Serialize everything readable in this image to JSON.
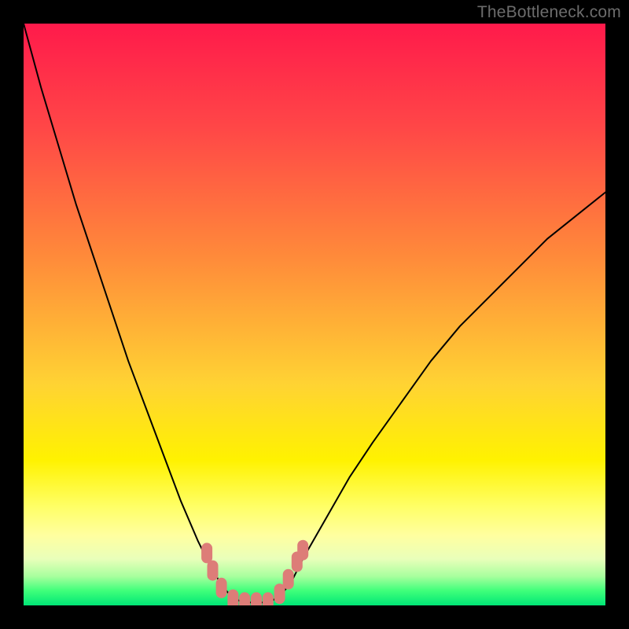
{
  "watermark": "TheBottleneck.com",
  "chart_data": {
    "type": "line",
    "title": "",
    "xlabel": "",
    "ylabel": "",
    "xlim": [
      0,
      100
    ],
    "ylim": [
      0,
      100
    ],
    "background_gradient_stops": [
      {
        "offset": 0,
        "color": "#ff1a4b"
      },
      {
        "offset": 0.18,
        "color": "#ff4747"
      },
      {
        "offset": 0.4,
        "color": "#ff8a3a"
      },
      {
        "offset": 0.62,
        "color": "#ffd333"
      },
      {
        "offset": 0.75,
        "color": "#fff200"
      },
      {
        "offset": 0.83,
        "color": "#ffff66"
      },
      {
        "offset": 0.88,
        "color": "#ffffa0"
      },
      {
        "offset": 0.92,
        "color": "#e9ffba"
      },
      {
        "offset": 0.95,
        "color": "#a8ff9e"
      },
      {
        "offset": 0.975,
        "color": "#3fff7a"
      },
      {
        "offset": 1.0,
        "color": "#00e676"
      }
    ],
    "series": [
      {
        "name": "bottleneck-curve",
        "stroke": "#000000",
        "stroke_width": 2,
        "points": [
          {
            "x": 0,
            "y": 0
          },
          {
            "x": 3,
            "y": 11
          },
          {
            "x": 6,
            "y": 21
          },
          {
            "x": 9,
            "y": 31
          },
          {
            "x": 12,
            "y": 40
          },
          {
            "x": 15,
            "y": 49
          },
          {
            "x": 18,
            "y": 58
          },
          {
            "x": 21,
            "y": 66
          },
          {
            "x": 24,
            "y": 74
          },
          {
            "x": 27,
            "y": 82
          },
          {
            "x": 30,
            "y": 89
          },
          {
            "x": 32,
            "y": 93
          },
          {
            "x": 34,
            "y": 96.5
          },
          {
            "x": 36,
            "y": 98.8
          },
          {
            "x": 38,
            "y": 99.5
          },
          {
            "x": 40,
            "y": 99.5
          },
          {
            "x": 42,
            "y": 99.5
          },
          {
            "x": 44,
            "y": 98.5
          },
          {
            "x": 46,
            "y": 96
          },
          {
            "x": 48,
            "y": 92
          },
          {
            "x": 52,
            "y": 85
          },
          {
            "x": 56,
            "y": 78
          },
          {
            "x": 60,
            "y": 72
          },
          {
            "x": 65,
            "y": 65
          },
          {
            "x": 70,
            "y": 58
          },
          {
            "x": 75,
            "y": 52
          },
          {
            "x": 80,
            "y": 47
          },
          {
            "x": 85,
            "y": 42
          },
          {
            "x": 90,
            "y": 37
          },
          {
            "x": 95,
            "y": 33
          },
          {
            "x": 100,
            "y": 29
          }
        ]
      },
      {
        "name": "highlight-markers",
        "type": "scatter",
        "stroke": "#dd7d78",
        "fill": "#dd7d78",
        "points": [
          {
            "x": 31.5,
            "y": 91
          },
          {
            "x": 32.5,
            "y": 94
          },
          {
            "x": 34,
            "y": 97
          },
          {
            "x": 36,
            "y": 99
          },
          {
            "x": 38,
            "y": 99.5
          },
          {
            "x": 40,
            "y": 99.5
          },
          {
            "x": 42,
            "y": 99.5
          },
          {
            "x": 44,
            "y": 98
          },
          {
            "x": 45.5,
            "y": 95.5
          },
          {
            "x": 47,
            "y": 92.5
          },
          {
            "x": 48,
            "y": 90.5
          }
        ]
      }
    ]
  }
}
